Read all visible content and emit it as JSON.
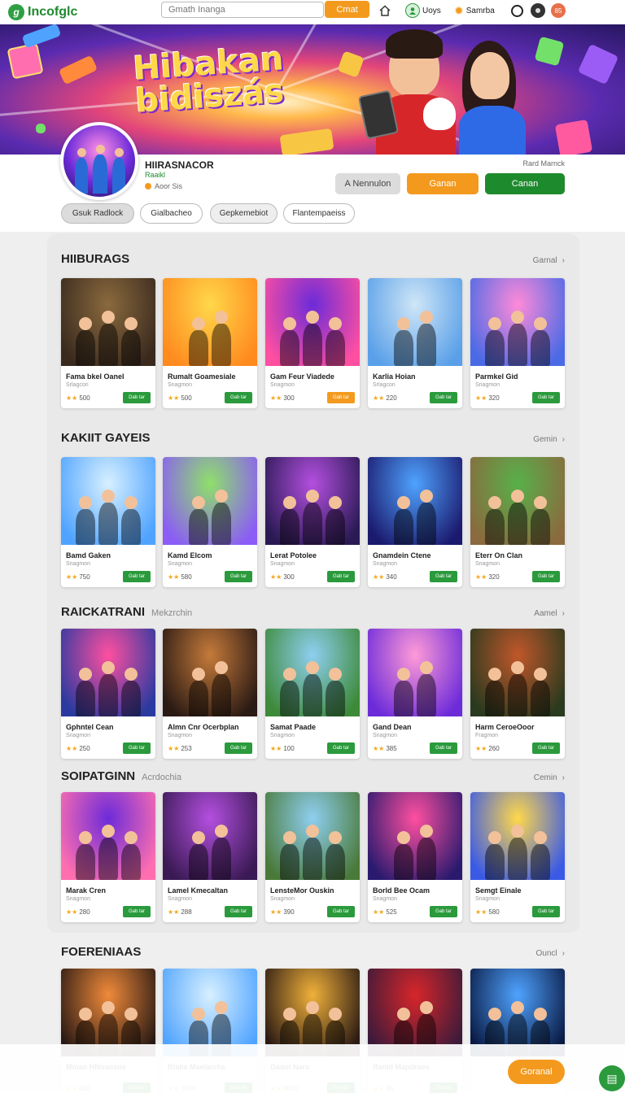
{
  "nav": {
    "logo_text": "Incofglc",
    "search_placeholder": "Gmath Inanga",
    "search_button": "Cmat",
    "links": [
      "Uoys",
      "Samrba"
    ],
    "badge": "85"
  },
  "banner": {
    "title": "Hibakan bidiszás"
  },
  "profile": {
    "name": "HIIRASNACOR",
    "subtitle": "Raaikl",
    "stat": "Aoor Sis",
    "corner_label": "Rard Marnck",
    "buttons": [
      "A Nennulon",
      "Ganan",
      "Canan"
    ]
  },
  "filters": [
    "Gsuk Radlock",
    "Gialbacheo",
    "Gepkemebiot",
    "Flantempaeiss"
  ],
  "sections": [
    {
      "title": "HIIBURAGS",
      "subtitle": "",
      "more": "Garnal",
      "cards": [
        {
          "name": "Fama bkel Oanel",
          "sub": "Srlagcon",
          "rating": "500",
          "btn": "Dab tar"
        },
        {
          "name": "Rumalt Goamesiale",
          "sub": "Snagmon",
          "rating": "500",
          "btn": "Gab tar"
        },
        {
          "name": "Gam Feur Viadede",
          "sub": "Snagmon",
          "rating": "300",
          "btn": "Gab tar"
        },
        {
          "name": "Karlia Hoian",
          "sub": "Srlagcon",
          "rating": "220",
          "btn": "Gab tar"
        },
        {
          "name": "Parmkel Gid",
          "sub": "Snagmon",
          "rating": "320",
          "btn": "Gab tar"
        }
      ]
    },
    {
      "title": "KAKIIT GAYEIS",
      "subtitle": "",
      "more": "Gemin",
      "cards": [
        {
          "name": "Bamd Gaken",
          "sub": "Snagmon",
          "rating": "750",
          "btn": "Gab tar"
        },
        {
          "name": "Kamd Elcom",
          "sub": "Snagmon",
          "rating": "580",
          "btn": "Gab tar"
        },
        {
          "name": "Lerat Potolee",
          "sub": "Snagmon",
          "rating": "300",
          "btn": "Gab tar"
        },
        {
          "name": "Gnamdein Ctene",
          "sub": "Snagmon",
          "rating": "340",
          "btn": "Gab tar"
        },
        {
          "name": "Eterr On Clan",
          "sub": "Snagmon",
          "rating": "320",
          "btn": "Gab tar"
        }
      ]
    },
    {
      "title": "RAICKATRANI",
      "subtitle": "Mekzrchin",
      "more": "Aamel",
      "cards": [
        {
          "name": "Gphntel Cean",
          "sub": "Snagmon",
          "rating": "250",
          "btn": "Gab tar"
        },
        {
          "name": "Almn Cnr Ocerbplan",
          "sub": "Snagmon",
          "rating": "253",
          "btn": "Gab tar"
        },
        {
          "name": "Samat Paade",
          "sub": "Snagmon",
          "rating": "100",
          "btn": "Gab tar"
        },
        {
          "name": "Gand Dean",
          "sub": "Snagmon",
          "rating": "385",
          "btn": "Gab tar"
        },
        {
          "name": "Harm CeroeOoor",
          "sub": "Fragmon",
          "rating": "260",
          "btn": "Gab tar"
        }
      ]
    },
    {
      "title": "SOIPATGINN",
      "subtitle": "Acrdochia",
      "more": "Cemin",
      "cards": [
        {
          "name": "Marak Cren",
          "sub": "Snagmon",
          "rating": "280",
          "btn": "Gab tar"
        },
        {
          "name": "Lamel Kmecaltan",
          "sub": "Snagmon",
          "rating": "288",
          "btn": "Gab tar"
        },
        {
          "name": "LensteMor Ouskin",
          "sub": "Snagmon",
          "rating": "390",
          "btn": "Gab tar"
        },
        {
          "name": "Borld Bee Ocam",
          "sub": "Snagmon",
          "rating": "525",
          "btn": "Gab tar"
        },
        {
          "name": "Semgt Einale",
          "sub": "Snagmon",
          "rating": "580",
          "btn": "Gab tar"
        }
      ]
    },
    {
      "title": "FOERENIAAS",
      "subtitle": "",
      "more": "Ouncl",
      "cards": [
        {
          "name": "Mman Hfilssoane",
          "sub": "",
          "rating": "200",
          "btn": "Gab tar"
        },
        {
          "name": "Rtalia Maelarche",
          "sub": "",
          "rating": "1000",
          "btn": "Gab tar"
        },
        {
          "name": "Gaant Nara",
          "sub": "",
          "rating": "6030",
          "btn": "Gab tar"
        },
        {
          "name": "Ranid Mapdroes",
          "sub": "",
          "rating": "85",
          "btn": "Gab tar"
        },
        {
          "name": "",
          "sub": "",
          "rating": "",
          "btn": ""
        }
      ]
    }
  ],
  "bottom": {
    "orange_button": "Goranal"
  },
  "colors": {
    "accent_orange": "#f39a1e",
    "accent_green": "#2a9a3c",
    "brand_green": "#1e8a2e"
  }
}
